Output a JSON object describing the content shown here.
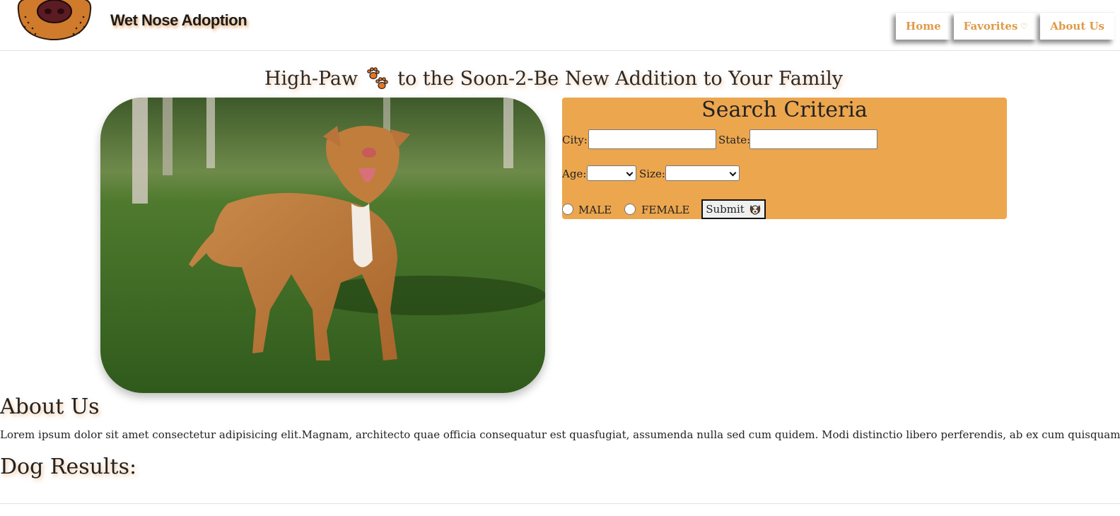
{
  "header": {
    "brand": "Wet Nose Adoption",
    "nav": [
      {
        "label": "Home"
      },
      {
        "label": "Favorites",
        "icon": "heart-icon"
      },
      {
        "label": "About Us"
      }
    ]
  },
  "hero": {
    "title_left": "High-Paw",
    "title_right": "to the Soon-2-Be New Addition to Your Family",
    "icon": "paw-prints-icon"
  },
  "search": {
    "title": "Search Criteria",
    "city_label": "City:",
    "city_value": "",
    "state_label": "State:",
    "state_value": "",
    "age_label": "Age:",
    "age_value": "",
    "size_label": "Size:",
    "size_value": "",
    "gender_options": [
      "MALE",
      "FEMALE"
    ],
    "submit_label": "Submit",
    "submit_icon": "dog-face-icon"
  },
  "about": {
    "heading": "About Us",
    "text": "Lorem ipsum dolor sit amet consectetur adipisicing elit.Magnam, architecto quae officia consequatur est quasfugiat, assumenda nulla sed cum quidem. Modi distinctio libero perferendis, ab ex cum quisquam quo!"
  },
  "results": {
    "heading": "Dog Results:"
  },
  "colors": {
    "accent": "#eca64e",
    "nav_text": "#e09a47"
  }
}
